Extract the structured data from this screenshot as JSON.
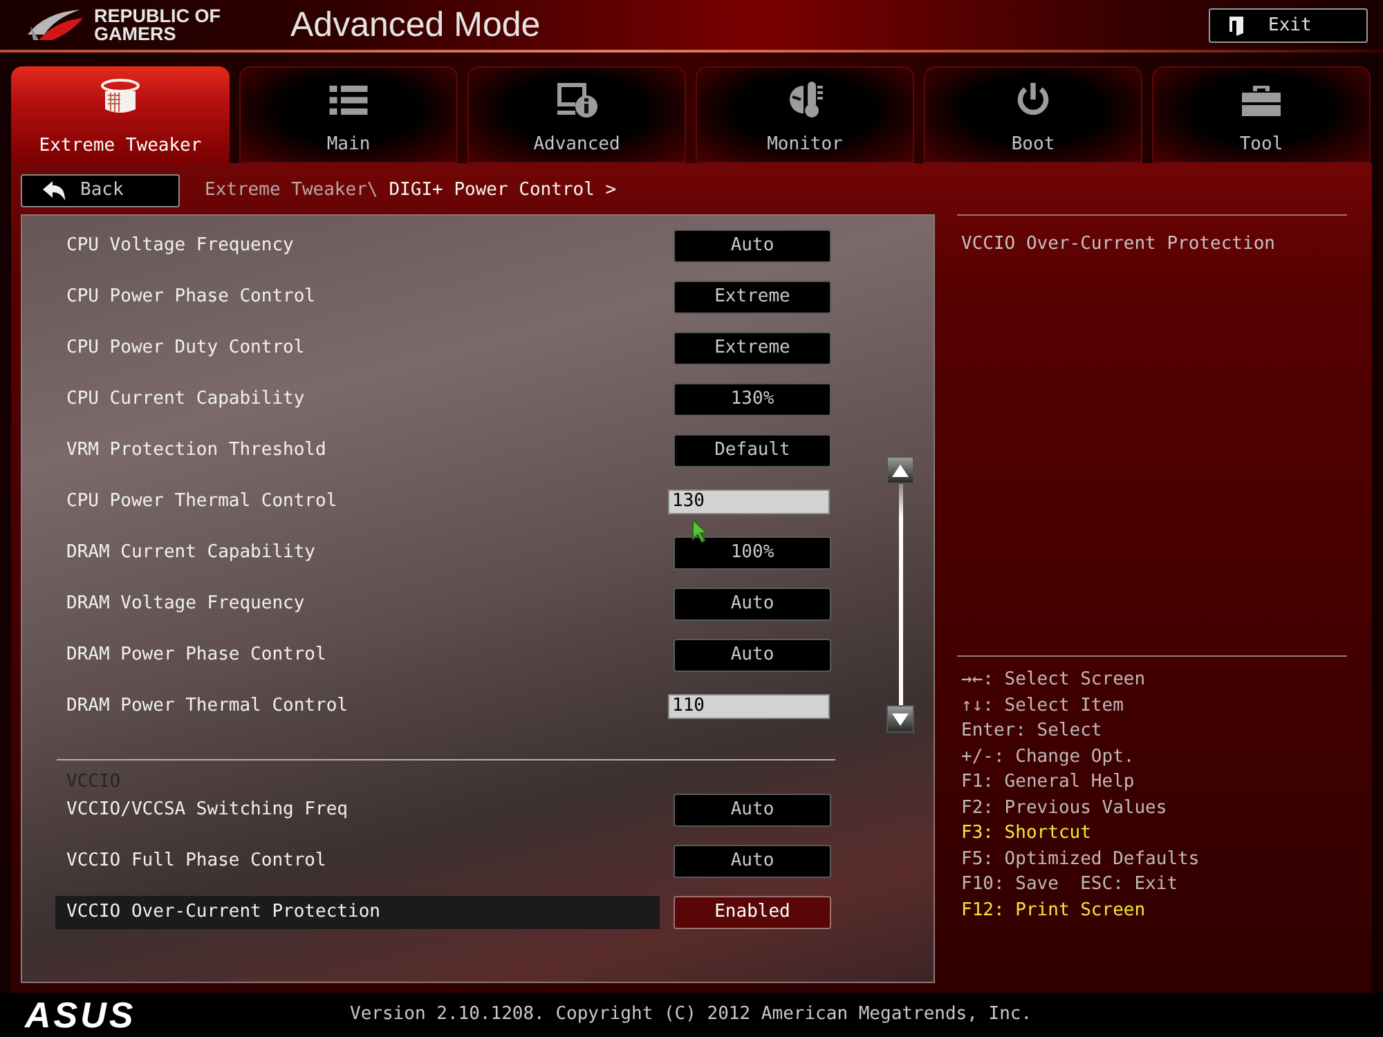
{
  "header": {
    "brand_lines": [
      "REPUBLIC OF",
      "GAMERS"
    ],
    "title": "Advanced Mode",
    "exit_button": "Exit"
  },
  "tabs": [
    {
      "label": "Extreme Tweaker",
      "selected": true
    },
    {
      "label": "Main",
      "selected": false
    },
    {
      "label": "Advanced",
      "selected": false
    },
    {
      "label": "Monitor",
      "selected": false
    },
    {
      "label": "Boot",
      "selected": false
    },
    {
      "label": "Tool",
      "selected": false
    }
  ],
  "toolbar": {
    "back_button": "Back",
    "breadcrumb": {
      "path": "Extreme Tweaker\\",
      "current": "DIGI+ Power Control >"
    }
  },
  "settings": {
    "groups": [
      {
        "rows": [
          {
            "kind": "option",
            "label": "CPU Voltage Frequency",
            "value": "Auto",
            "selected": false
          },
          {
            "kind": "option",
            "label": "CPU Power Phase Control",
            "value": "Extreme",
            "selected": false
          },
          {
            "kind": "option",
            "label": "CPU Power Duty Control",
            "value": "Extreme",
            "selected": false
          },
          {
            "kind": "option",
            "label": "CPU Current Capability",
            "value": "130%",
            "selected": false
          },
          {
            "kind": "option",
            "label": "VRM Protection Threshold",
            "value": "Default",
            "selected": false
          },
          {
            "kind": "number",
            "label": "CPU Power Thermal Control",
            "value": "130",
            "selected": false
          },
          {
            "kind": "option",
            "label": "DRAM Current Capability",
            "value": "100%",
            "selected": false
          },
          {
            "kind": "option",
            "label": "DRAM Voltage Frequency",
            "value": "Auto",
            "selected": false
          },
          {
            "kind": "option",
            "label": "DRAM Power Phase Control",
            "value": "Auto",
            "selected": false
          },
          {
            "kind": "number",
            "label": "DRAM Power Thermal Control",
            "value": "110",
            "selected": false
          }
        ]
      },
      {
        "title": "VCCIO",
        "rows": [
          {
            "kind": "option",
            "label": "VCCIO/VCCSA Switching Freq",
            "value": "Auto",
            "selected": false
          },
          {
            "kind": "option",
            "label": "VCCIO Full Phase Control",
            "value": "Auto",
            "selected": false
          },
          {
            "kind": "option",
            "label": "VCCIO Over-Current Protection",
            "value": "Enabled",
            "selected": true
          }
        ]
      }
    ]
  },
  "help": {
    "description": "VCCIO Over-Current Protection",
    "keys": [
      {
        "text": "→←: Select Screen",
        "highlighted": false
      },
      {
        "text": "↑↓: Select Item",
        "highlighted": false
      },
      {
        "text": "Enter: Select",
        "highlighted": false
      },
      {
        "text": "+/-: Change Opt.",
        "highlighted": false
      },
      {
        "text": "F1: General Help",
        "highlighted": false
      },
      {
        "text": "F2: Previous Values",
        "highlighted": false
      },
      {
        "text": "F3: Shortcut",
        "highlighted": true
      },
      {
        "text": "F5: Optimized Defaults",
        "highlighted": false
      },
      {
        "text": "F10: Save  ESC: Exit",
        "highlighted": false
      },
      {
        "text": "F12: Print Screen",
        "highlighted": true
      }
    ]
  },
  "footer": {
    "logo": "ASUS",
    "version": "Version 2.10.1208. Copyright (C) 2012 American Megatrends, Inc."
  }
}
